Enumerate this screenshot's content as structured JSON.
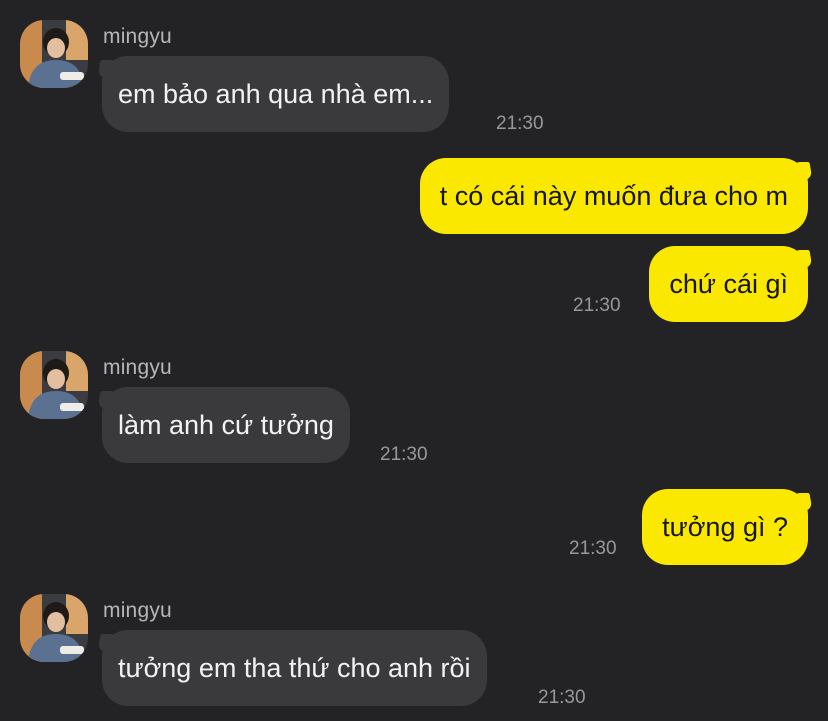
{
  "messages": [
    {
      "direction": "in",
      "sender": "mingyu",
      "text": "em bảo anh qua nhà em...",
      "time": "21:30"
    },
    {
      "direction": "out",
      "text": "t có cái này muốn đưa cho m",
      "time": ""
    },
    {
      "direction": "out",
      "text": "chứ cái gì",
      "time": "21:30"
    },
    {
      "direction": "in",
      "sender": "mingyu",
      "text": "làm anh cứ tưởng",
      "time": "21:30"
    },
    {
      "direction": "out",
      "text": "tưởng gì ?",
      "time": "21:30"
    },
    {
      "direction": "in",
      "sender": "mingyu",
      "text": "tưởng em tha thứ cho anh rồi",
      "time": "21:30"
    }
  ],
  "icons": {
    "avatar": "mingyu-avatar-photo"
  },
  "colors": {
    "background": "#232325",
    "incoming_bubble": "#3a3a3d",
    "outgoing_bubble": "#fbe800",
    "incoming_text": "#f2f2f2",
    "outgoing_text": "#16161a",
    "sender_name": "#b6b6b8",
    "timestamp": "#98989c"
  }
}
